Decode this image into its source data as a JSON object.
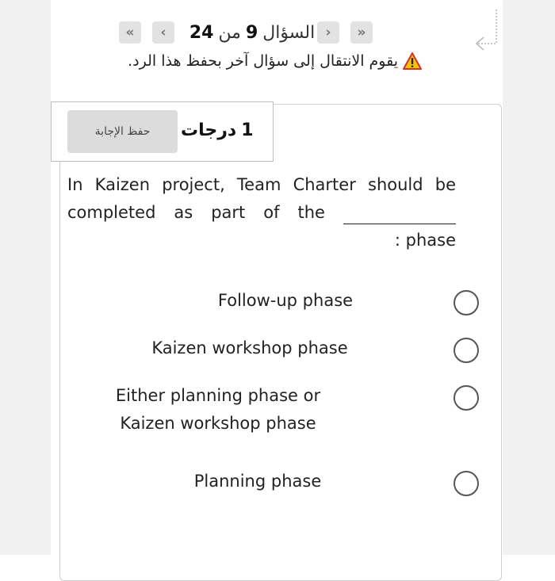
{
  "nav": {
    "question_word": "السؤال",
    "current": "9",
    "of_word": "من",
    "total": "24",
    "first_icon": "double-chevron-left",
    "prev_icon": "chevron-left",
    "next_icon": "chevron-right",
    "last_icon": "double-chevron-right"
  },
  "warning": {
    "icon": "warning-triangle",
    "text": "يقوم الانتقال إلى سؤال آخر بحفظ هذا الرد."
  },
  "question": {
    "points": "1",
    "points_label": "درجات",
    "save_label": "حفظ الإجابة",
    "text_line1_words": [
      "In",
      "Kaizen",
      "project,",
      "Team",
      "Charter",
      "should",
      "be"
    ],
    "text_line2_words": [
      "completed",
      "as",
      "part",
      "of",
      "the"
    ],
    "text_line3": ": phase"
  },
  "options": [
    {
      "line1": "Follow-up phase"
    },
    {
      "line1": "Kaizen workshop phase"
    },
    {
      "line1": "Either planning phase or",
      "line2": "Kaizen workshop phase"
    },
    {
      "line1": "Planning phase"
    }
  ],
  "colors": {
    "nav_button_bg": "#e2e2e2",
    "save_button_bg": "#dcdcdc",
    "warning_yellow": "#f5c400",
    "warning_red": "#d9302c"
  }
}
